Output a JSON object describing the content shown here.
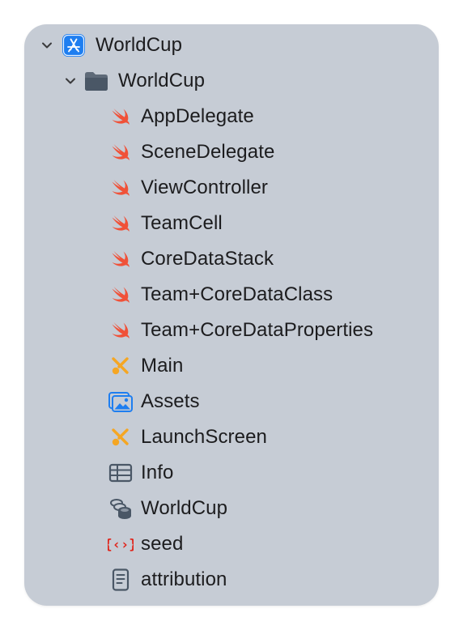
{
  "navigator": {
    "project": {
      "label": "WorldCup",
      "icon": "app-project-icon",
      "expanded": true
    },
    "group": {
      "label": "WorldCup",
      "icon": "folder-icon",
      "expanded": true
    },
    "files": [
      {
        "label": "AppDelegate",
        "icon": "swift-file-icon"
      },
      {
        "label": "SceneDelegate",
        "icon": "swift-file-icon"
      },
      {
        "label": "ViewController",
        "icon": "swift-file-icon"
      },
      {
        "label": "TeamCell",
        "icon": "swift-file-icon"
      },
      {
        "label": "CoreDataStack",
        "icon": "swift-file-icon"
      },
      {
        "label": "Team+CoreDataClass",
        "icon": "swift-file-icon"
      },
      {
        "label": "Team+CoreDataProperties",
        "icon": "swift-file-icon"
      },
      {
        "label": "Main",
        "icon": "storyboard-icon"
      },
      {
        "label": "Assets",
        "icon": "asset-catalog-icon"
      },
      {
        "label": "LaunchScreen",
        "icon": "storyboard-icon"
      },
      {
        "label": "Info",
        "icon": "plist-icon"
      },
      {
        "label": "WorldCup",
        "icon": "data-model-icon"
      },
      {
        "label": "seed",
        "icon": "json-file-icon"
      },
      {
        "label": "attribution",
        "icon": "text-file-icon"
      }
    ]
  },
  "colors": {
    "panel_background": "#c6ccd5",
    "swift_orange": "#f05138",
    "storyboard_orange": "#f5a623",
    "accent_blue": "#1e7ef0",
    "json_red": "#e0261d",
    "neutral_icon": "#4a5766"
  }
}
